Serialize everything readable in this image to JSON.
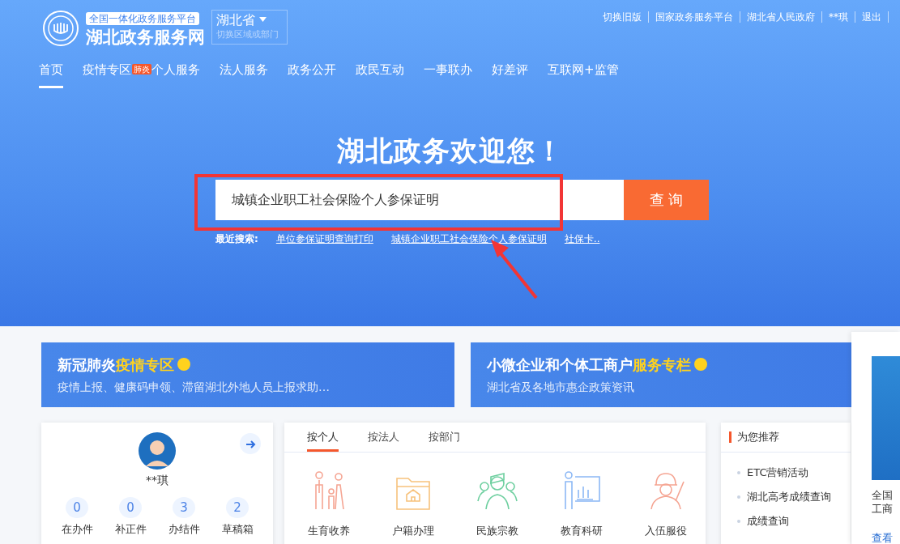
{
  "header": {
    "platform_tag": "全国一体化政务服务平台",
    "site_name": "湖北政务服务网",
    "region": "湖北省",
    "region_hint": "切换区域或部门",
    "top_links": [
      "切换旧版",
      "国家政务服务平台",
      "湖北省人民政府",
      "**琪",
      "退出"
    ]
  },
  "nav": [
    {
      "label": "首页",
      "selected": true
    },
    {
      "label": "疫情专区",
      "selected": false,
      "badge": "肺炎"
    },
    {
      "label": "个人服务",
      "selected": false
    },
    {
      "label": "法人服务",
      "selected": false
    },
    {
      "label": "政务公开",
      "selected": false
    },
    {
      "label": "政民互动",
      "selected": false
    },
    {
      "label": "一事联办",
      "selected": false
    },
    {
      "label": "好差评",
      "selected": false
    },
    {
      "label": "互联网+监管",
      "selected": false
    }
  ],
  "hero": {
    "title": "湖北政务欢迎您！",
    "search_value": "城镇企业职工社会保险个人参保证明",
    "search_button": "查 询",
    "recent_label": "最近搜索:",
    "recent": [
      "单位参保证明查询打印",
      "城镇企业职工社会保险个人参保证明",
      "社保卡.."
    ]
  },
  "banners": [
    {
      "title": "新冠肺炎",
      "highlight": "疫情专区",
      "subtitle": "疫情上报、健康码申领、滞留湖北外地人员上报求助…"
    },
    {
      "title": "小微企业和个体工商户",
      "highlight": "服务专栏",
      "subtitle": "湖北省及各地市惠企政策资讯"
    }
  ],
  "user": {
    "name": "**琪",
    "stats": [
      {
        "count": "0",
        "label": "在办件"
      },
      {
        "count": "0",
        "label": "补正件"
      },
      {
        "count": "3",
        "label": "办结件"
      },
      {
        "count": "2",
        "label": "草稿箱"
      }
    ]
  },
  "services": {
    "tabs": [
      {
        "label": "按个人",
        "selected": true
      },
      {
        "label": "按法人",
        "selected": false
      },
      {
        "label": "按部门",
        "selected": false
      }
    ],
    "items": [
      {
        "label": "生育收养",
        "kind": "family"
      },
      {
        "label": "户籍办理",
        "kind": "folder"
      },
      {
        "label": "民族宗教",
        "kind": "people"
      },
      {
        "label": "教育科研",
        "kind": "teacher"
      },
      {
        "label": "入伍服役",
        "kind": "worker"
      }
    ]
  },
  "recommend": {
    "title": "为您推荐",
    "items": [
      "ETC营销活动",
      "湖北高考成绩查询",
      "成绩查询"
    ]
  },
  "side_panel": {
    "lines": [
      "全国",
      "工商"
    ],
    "link": "查看"
  }
}
